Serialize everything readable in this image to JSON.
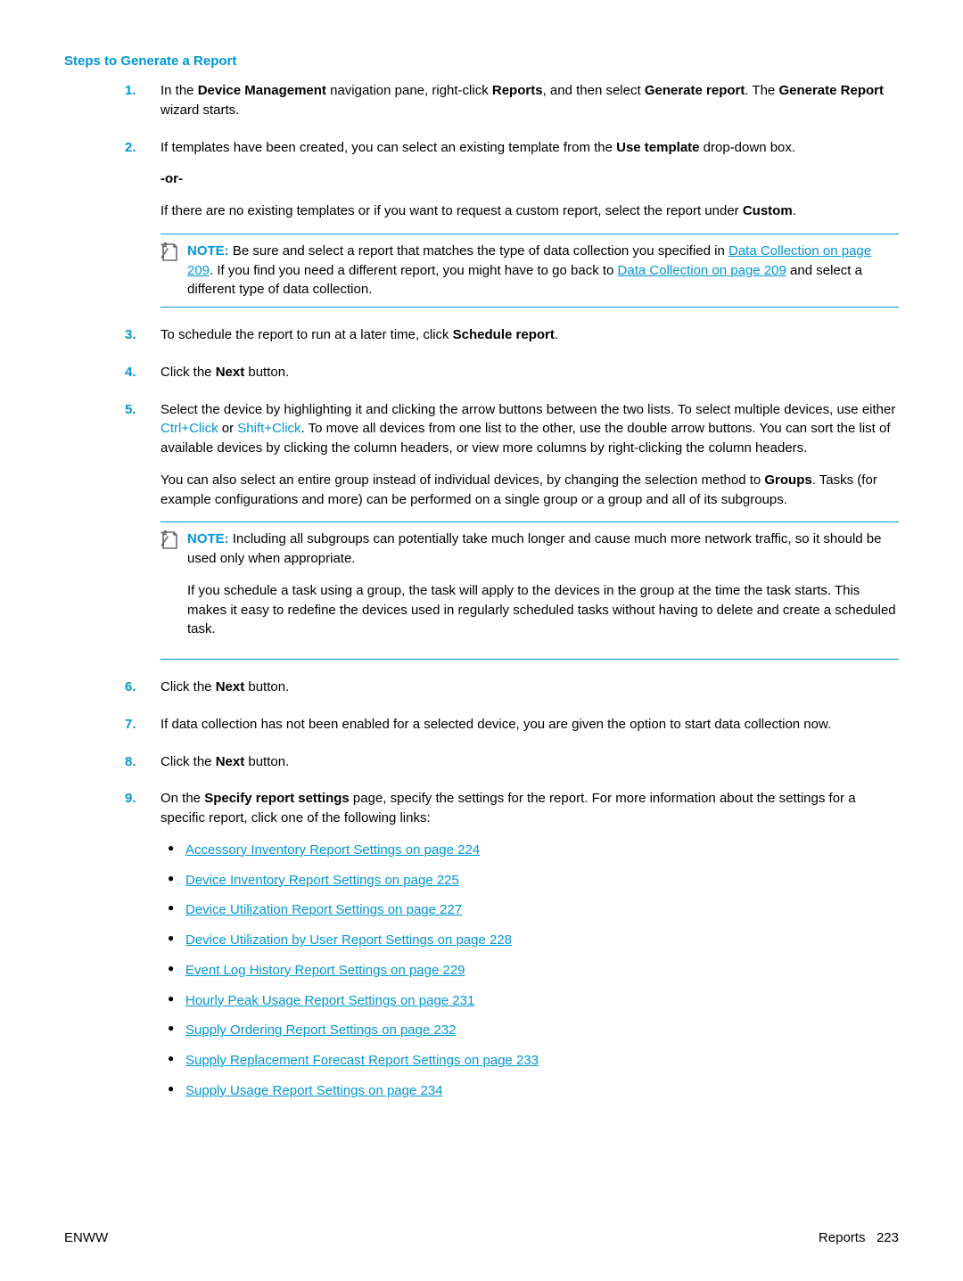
{
  "heading": "Steps to Generate a Report",
  "steps": [
    {
      "num": "1.",
      "runs": [
        {
          "t": "In the "
        },
        {
          "t": "Device Management",
          "b": true
        },
        {
          "t": " navigation pane, right-click "
        },
        {
          "t": "Reports",
          "b": true
        },
        {
          "t": ", and then select "
        },
        {
          "t": "Generate report",
          "b": true
        },
        {
          "t": ". The "
        },
        {
          "t": "Generate Report",
          "b": true
        },
        {
          "t": " wizard starts."
        }
      ]
    },
    {
      "num": "2.",
      "runs": [
        {
          "t": "If templates have been created, you can select an existing template from the "
        },
        {
          "t": "Use template",
          "b": true
        },
        {
          "t": " drop-down box."
        }
      ],
      "or": "-or-",
      "runs2": [
        {
          "t": "If there are no existing templates or if you want to request a custom report, select the report under "
        },
        {
          "t": "Custom",
          "b": true
        },
        {
          "t": "."
        }
      ],
      "note": {
        "label": "NOTE:",
        "segments": [
          {
            "t": "Be sure and select a report that matches the type of data collection you specified in "
          },
          {
            "t": "Data Collection on page 209",
            "link": true
          },
          {
            "t": ". If you find you need a different report, you might have to go back to "
          },
          {
            "t": "Data Collection on page 209",
            "link": true
          },
          {
            "t": " and select a different type of data collection."
          }
        ]
      }
    },
    {
      "num": "3.",
      "runs": [
        {
          "t": "To schedule the report to run at a later time, click "
        },
        {
          "t": "Schedule report",
          "b": true
        },
        {
          "t": "."
        }
      ]
    },
    {
      "num": "4.",
      "runs": [
        {
          "t": "Click the "
        },
        {
          "t": "Next",
          "b": true
        },
        {
          "t": " button."
        }
      ]
    },
    {
      "num": "5.",
      "runs": [
        {
          "t": "Select the device by highlighting it and clicking the arrow buttons between the two lists. To select multiple devices, use either "
        },
        {
          "t": "Ctrl+Click",
          "kbd": true
        },
        {
          "t": " or "
        },
        {
          "t": "Shift+Click",
          "kbd": true
        },
        {
          "t": ". To move all devices from one list to the other, use the double arrow buttons. You can sort the list of available devices by clicking the column headers, or view more columns by right-clicking the column headers."
        }
      ],
      "runs2": [
        {
          "t": "You can also select an entire group instead of individual devices, by changing the selection method to "
        },
        {
          "t": "Groups",
          "b": true
        },
        {
          "t": ". Tasks (for example configurations and more) can be performed on a single group or a group and all of its subgroups."
        }
      ],
      "note": {
        "label": "NOTE:",
        "segments": [
          {
            "t": "Including all subgroups can potentially take much longer and cause much more network traffic, so it should be used only when appropriate."
          }
        ],
        "extra": [
          {
            "t": "If you schedule a task using a group, the task will apply to the devices in the group at the time the task starts. This makes it easy to redefine the devices used in regularly scheduled tasks without having to delete and create a scheduled task."
          }
        ]
      }
    },
    {
      "num": "6.",
      "runs": [
        {
          "t": "Click the "
        },
        {
          "t": "Next",
          "b": true
        },
        {
          "t": " button."
        }
      ]
    },
    {
      "num": "7.",
      "runs": [
        {
          "t": "If data collection has not been enabled for a selected device, you are given the option to start data collection now."
        }
      ]
    },
    {
      "num": "8.",
      "runs": [
        {
          "t": "Click the "
        },
        {
          "t": "Next",
          "b": true
        },
        {
          "t": " button."
        }
      ]
    },
    {
      "num": "9.",
      "runs": [
        {
          "t": "On the "
        },
        {
          "t": "Specify report settings",
          "b": true
        },
        {
          "t": " page, specify the settings for the report. For more information about the settings for a specific report, click one of the following links:"
        }
      ],
      "bullets": [
        "Accessory Inventory Report Settings on page 224",
        "Device Inventory Report Settings on page 225",
        "Device Utilization Report Settings on page 227",
        "Device Utilization by User Report Settings on page 228",
        "Event Log History Report Settings on page 229",
        "Hourly Peak Usage Report Settings on page 231",
        "Supply Ordering Report Settings on page 232",
        "Supply Replacement Forecast Report Settings on page 233",
        "Supply Usage Report Settings on page 234"
      ]
    }
  ],
  "footer": {
    "left": "ENWW",
    "right_label": "Reports",
    "right_page": "223"
  },
  "runtime": {
    "note_indent": "   "
  }
}
